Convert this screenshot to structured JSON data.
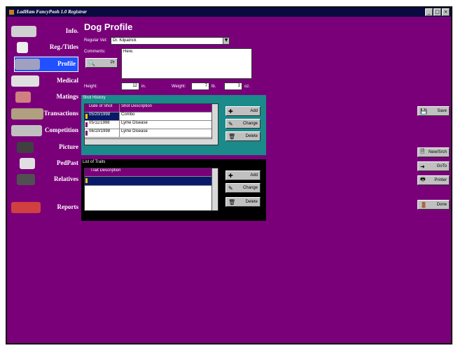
{
  "window": {
    "title": "LadHam FancyPooh 1.0 Registrar"
  },
  "nav": [
    {
      "label": "Info."
    },
    {
      "label": "Reg./Titles"
    },
    {
      "label": "Profile"
    },
    {
      "label": "Medical"
    },
    {
      "label": "Matings"
    },
    {
      "label": "Transactions"
    },
    {
      "label": "Competition"
    },
    {
      "label": "Picture"
    },
    {
      "label": "PedPast"
    },
    {
      "label": "Relatives"
    },
    {
      "label": "Reports"
    }
  ],
  "page_title": "Dog Profile",
  "form": {
    "vet_label": "Regular Vet:",
    "vet_value": "Dr. Kilpatrick",
    "comments_label": "Comments:",
    "comments_value": "Here.",
    "spell_button": "Pr",
    "height_label": "Height:",
    "height_value": "12",
    "height_unit": "in.",
    "weight_label": "Weight:",
    "weight_lbs": "7",
    "weight_lbs_unit": "lb.",
    "weight_oz": "3",
    "weight_oz_unit": "oz."
  },
  "shot_history": {
    "title": "Shot History",
    "headers": [
      "Date of Shot",
      "Shot Description"
    ],
    "rows": [
      [
        "05/20/1998",
        "Combo"
      ],
      [
        "05/11/1998",
        "Lyme Disease"
      ],
      [
        "06/10/1998",
        "Lyme Disease"
      ]
    ],
    "buttons": {
      "add": "Add",
      "change": "Change",
      "delete": "Delete"
    }
  },
  "traits": {
    "title": "List of Traits",
    "header": "Trait Description",
    "buttons": {
      "add": "Add",
      "change": "Change",
      "delete": "Delete"
    }
  },
  "right_buttons": {
    "save": "Save",
    "new_search": "New/Srch",
    "goto": "GoTo",
    "print": "Printer",
    "done": "Done"
  },
  "colors": {
    "background": "#7a007a",
    "nav_selected": "#2050ff",
    "shot_panel": "#1a8a8a",
    "trait_panel": "#000000"
  }
}
